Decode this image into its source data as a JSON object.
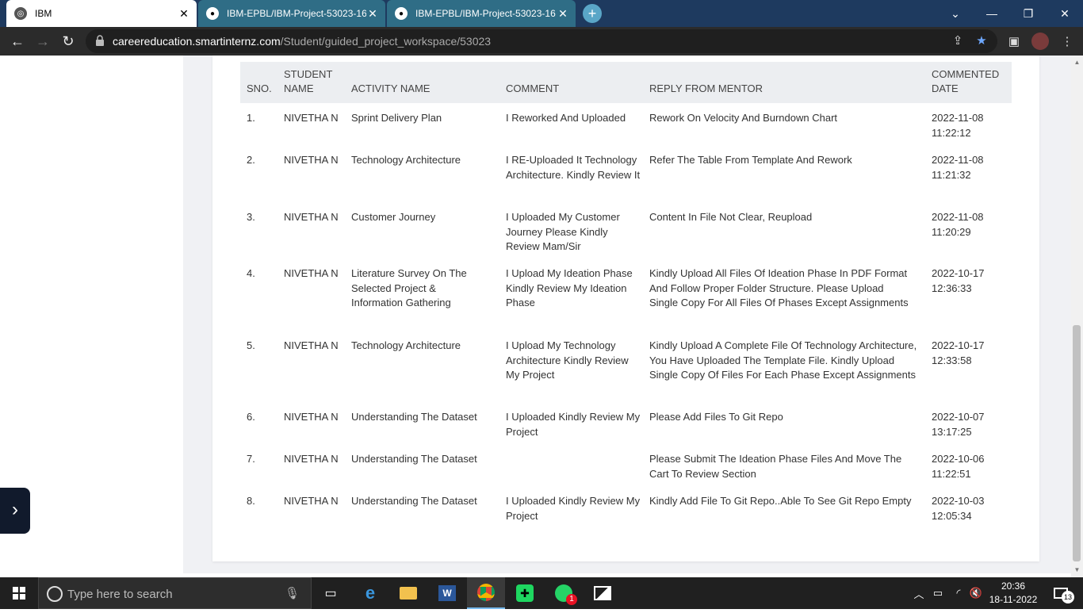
{
  "browser": {
    "tabs": [
      {
        "title": "IBM",
        "active": true
      },
      {
        "title": "IBM-EPBL/IBM-Project-53023-16",
        "active": false
      },
      {
        "title": "IBM-EPBL/IBM-Project-53023-16",
        "active": false
      }
    ],
    "url_host": "careereducation.smartinternz.com",
    "url_path": "/Student/guided_project_workspace/53023"
  },
  "table": {
    "headers": {
      "sno": "SNO.",
      "student_name_1": "STUDENT",
      "student_name_2": "NAME",
      "activity": "ACTIVITY NAME",
      "comment": "COMMENT",
      "reply": "REPLY FROM MENTOR",
      "date_1": "COMMENTED",
      "date_2": "DATE"
    },
    "rows": [
      {
        "sno": "1.",
        "name": "NIVETHA N",
        "activity": "Sprint Delivery Plan",
        "comment": "I Reworked And Uploaded",
        "reply": "Rework On Velocity And Burndown Chart",
        "date": "2022-11-08",
        "time": "11:22:12"
      },
      {
        "sno": "2.",
        "name": "NIVETHA N",
        "activity": "Technology Architecture",
        "comment": "I RE-Uploaded It Technology Architecture. Kindly Review It",
        "reply": "Refer The Table From Template And Rework",
        "date": "2022-11-08",
        "time": "11:21:32"
      },
      {
        "sno": "3.",
        "name": "NIVETHA N",
        "activity": "Customer Journey",
        "comment": "I Uploaded My Customer Journey Please Kindly Review Mam/Sir",
        "reply": "Content In File Not Clear, Reupload",
        "date": "2022-11-08",
        "time": "11:20:29"
      },
      {
        "sno": "4.",
        "name": "NIVETHA N",
        "activity": "Literature Survey On The Selected Project & Information Gathering",
        "comment": "I Upload My Ideation Phase Kindly Review My Ideation Phase",
        "reply": "Kindly Upload All Files Of Ideation Phase In PDF Format And Follow Proper Folder Structure. Please Upload Single Copy For All Files Of Phases Except Assignments",
        "date": "2022-10-17",
        "time": "12:36:33"
      },
      {
        "sno": "5.",
        "name": "NIVETHA N",
        "activity": "Technology Architecture",
        "comment": "I Upload My Technology Architecture Kindly Review My Project",
        "reply": "Kindly Upload A Complete File Of Technology Architecture, You Have Uploaded The Template File. Kindly Upload Single Copy Of Files For Each Phase Except Assignments",
        "date": "2022-10-17",
        "time": "12:33:58"
      },
      {
        "sno": "6.",
        "name": "NIVETHA N",
        "activity": "Understanding The Dataset",
        "comment": "I Uploaded Kindly Review My Project",
        "reply": "Please Add Files To Git Repo",
        "date": "2022-10-07",
        "time": "13:17:25"
      },
      {
        "sno": "7.",
        "name": "NIVETHA N",
        "activity": "Understanding The Dataset",
        "comment": "",
        "reply": "Please Submit The Ideation Phase Files And Move The Cart To Review Section",
        "date": "2022-10-06",
        "time": "11:22:51"
      },
      {
        "sno": "8.",
        "name": "NIVETHA N",
        "activity": "Understanding The Dataset",
        "comment": "I Uploaded Kindly Review My Project",
        "reply": "Kindly Add File To Git Repo..Able To See Git Repo Empty",
        "date": "2022-10-03",
        "time": "12:05:34"
      }
    ]
  },
  "taskbar": {
    "search_placeholder": "Type here to search",
    "time": "20:36",
    "date": "18-11-2022",
    "notification_count": "13",
    "whatsapp_badge": "1"
  }
}
